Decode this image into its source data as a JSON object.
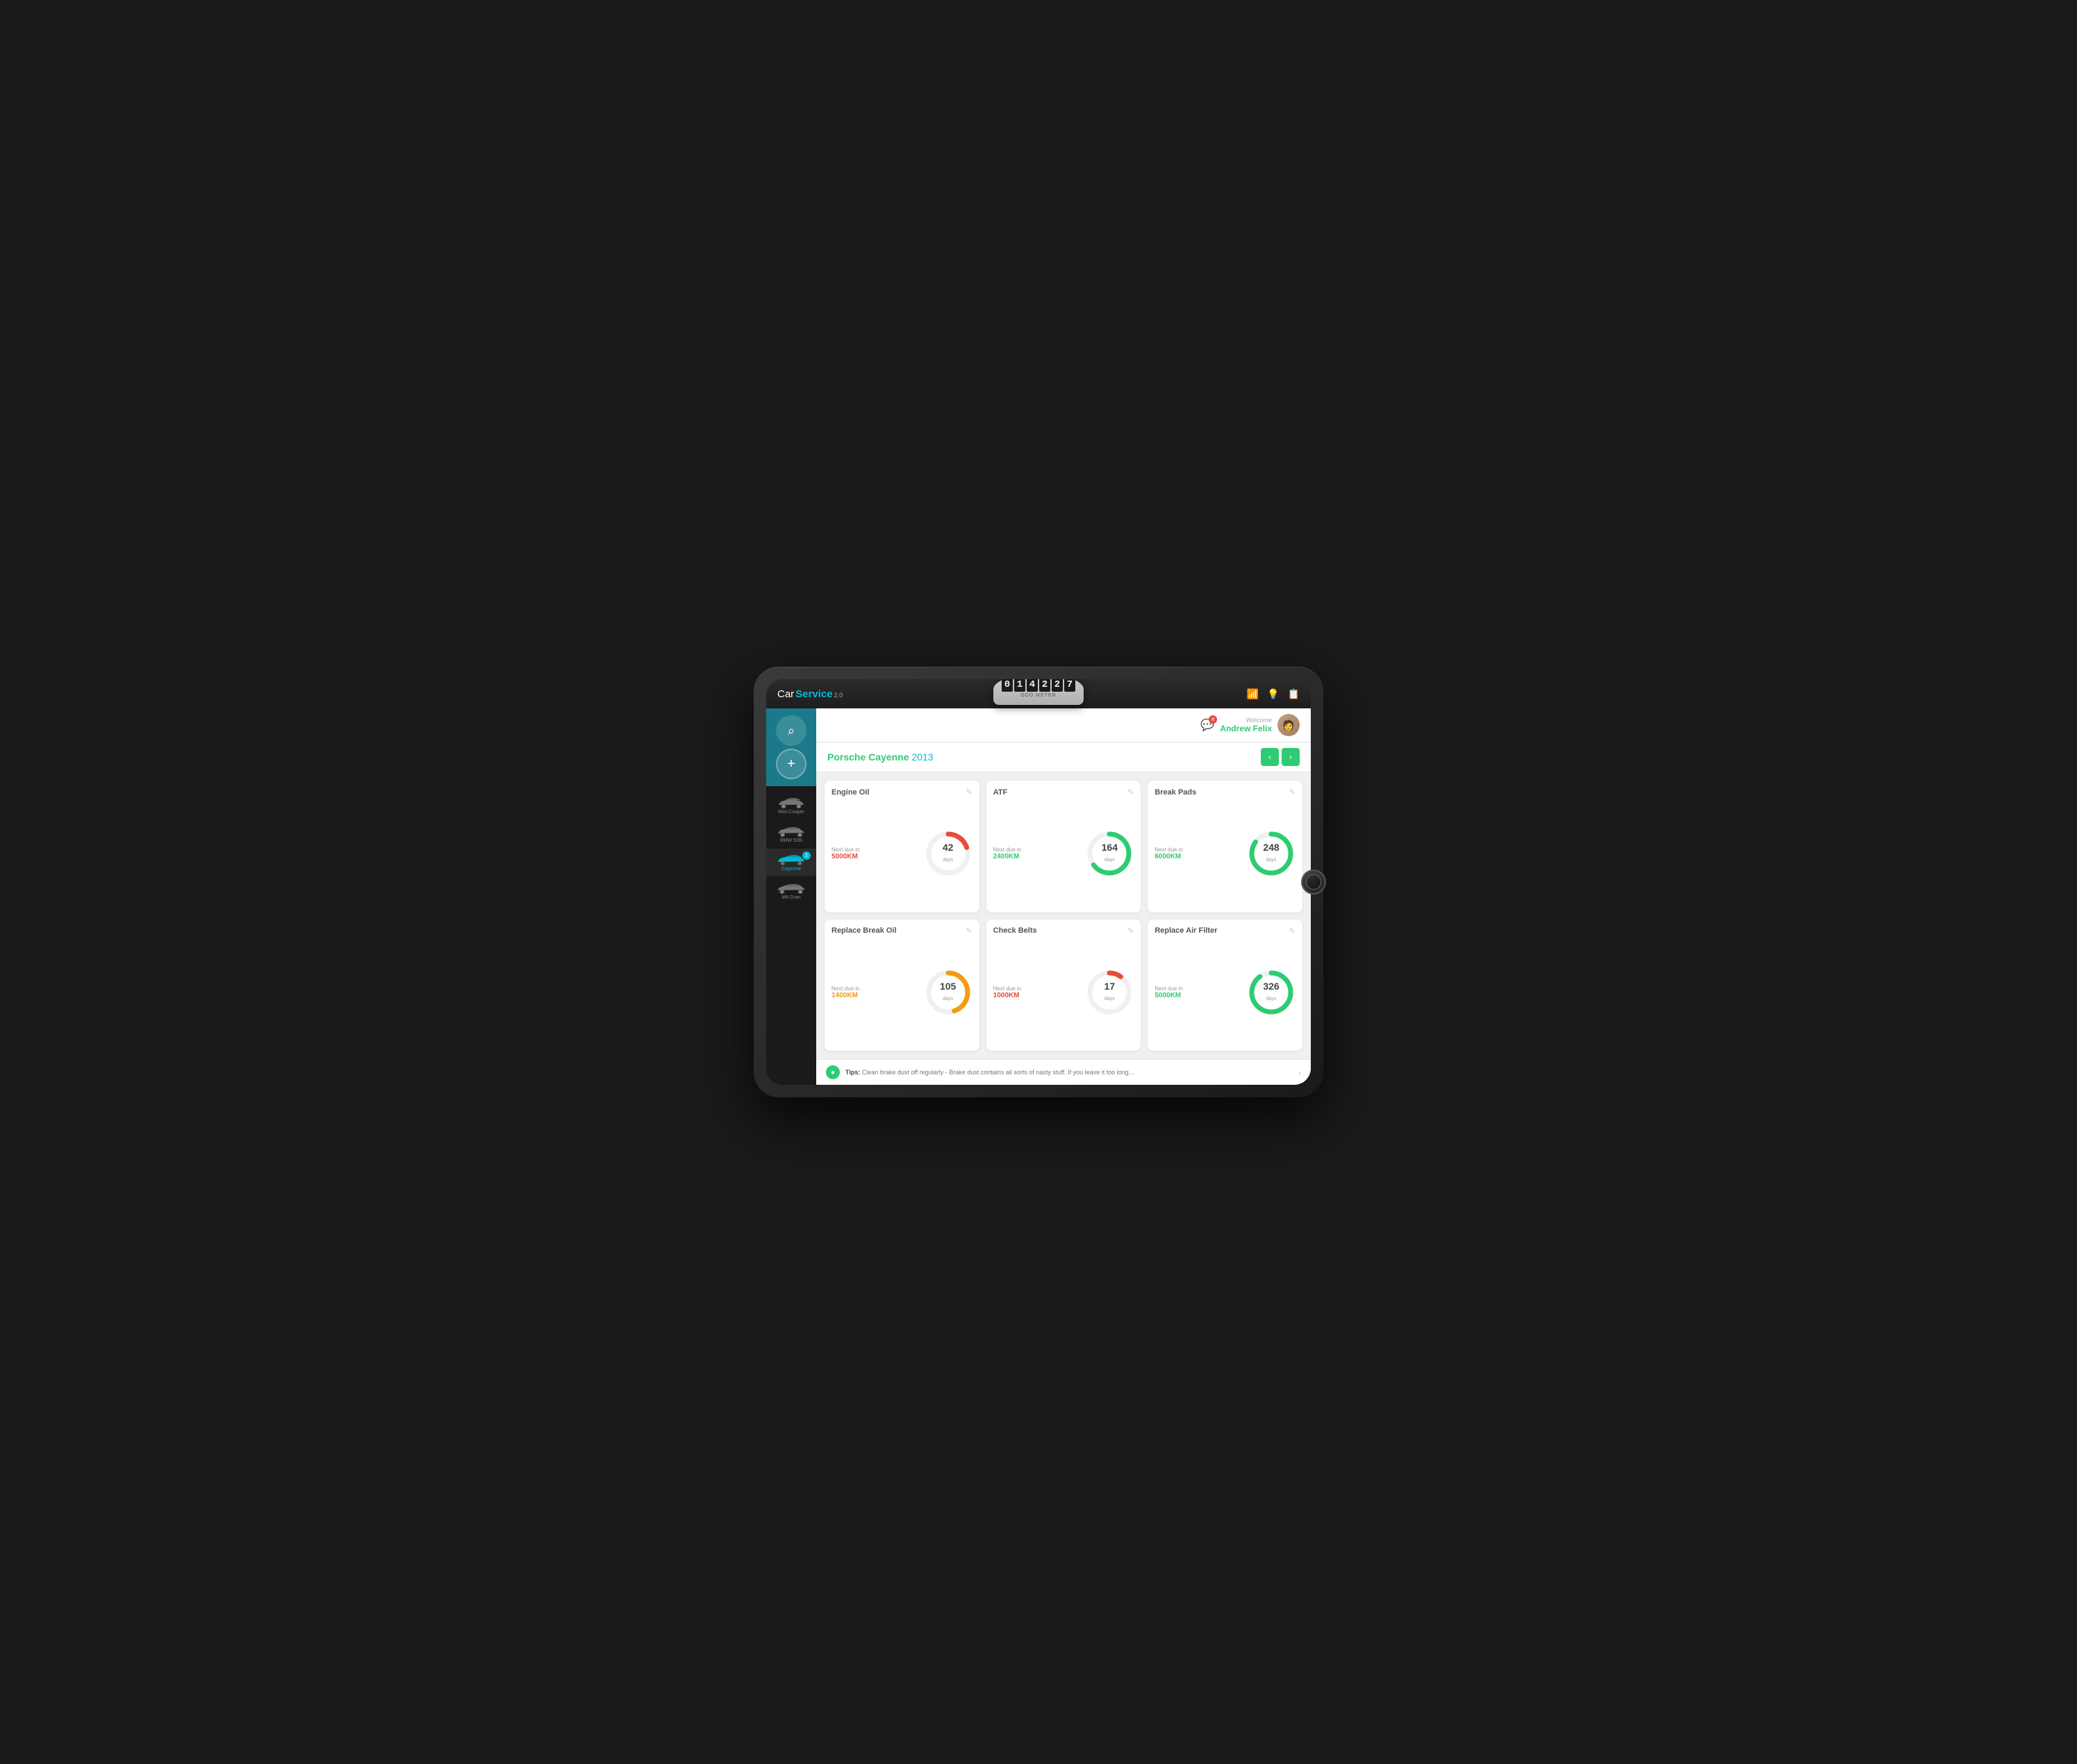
{
  "app": {
    "logo_car": "Car",
    "logo_service": "Service",
    "logo_version": "2.0"
  },
  "odo": {
    "digits": [
      "0",
      "1",
      "4",
      "2",
      "2",
      "7"
    ],
    "label": "ODO METER"
  },
  "top_icons": [
    "wifi",
    "bulb",
    "clipboard"
  ],
  "header": {
    "welcome_label": "Welcome",
    "user_name": "Andrew Felix",
    "notification_count": "8"
  },
  "car_selected": {
    "make": "Porsche Cayenne",
    "year": "2013"
  },
  "sidebar": {
    "cars": [
      {
        "name": "Mini Cooper",
        "active": false,
        "badge": null
      },
      {
        "name": "BMW 528i",
        "active": false,
        "badge": null
      },
      {
        "name": "Cayenne",
        "active": true,
        "badge": "2"
      },
      {
        "name": "M6 Gran",
        "active": false,
        "badge": null
      }
    ]
  },
  "service_cards": [
    {
      "title": "Engine Oil",
      "edit": "✎",
      "next_due_label": "Next due in",
      "next_due_km": "5000KM",
      "km_color": "red",
      "days": "42",
      "unit": "days",
      "donut_color": "#e74c3c",
      "donut_pct": 20
    },
    {
      "title": "ATF",
      "edit": "✎",
      "next_due_label": "Next due in",
      "next_due_km": "2400KM",
      "km_color": "green",
      "days": "164",
      "unit": "days",
      "donut_color": "#2ecc71",
      "donut_pct": 65
    },
    {
      "title": "Break Pads",
      "edit": "✎",
      "next_due_label": "Next due in",
      "next_due_km": "6000KM",
      "km_color": "green",
      "days": "248",
      "unit": "days",
      "donut_color": "#2ecc71",
      "donut_pct": 85
    },
    {
      "title": "Replace Break Oil",
      "edit": "✎",
      "next_due_label": "Next due in",
      "next_due_km": "1400KM",
      "km_color": "orange",
      "days": "105",
      "unit": "days",
      "donut_color": "#f39c12",
      "donut_pct": 45
    },
    {
      "title": "Check Belts",
      "edit": "✎",
      "next_due_label": "Next due in",
      "next_due_km": "1000KM",
      "km_color": "red",
      "days": "17",
      "unit": "days",
      "donut_color": "#e74c3c",
      "donut_pct": 10
    },
    {
      "title": "Replace Air Filter",
      "edit": "✎",
      "next_due_label": "Next due in",
      "next_due_km": "5000KM",
      "km_color": "green",
      "days": "326",
      "unit": "days",
      "donut_color": "#2ecc71",
      "donut_pct": 90
    }
  ],
  "tips": {
    "label": "Tips:",
    "text": "Clean brake dust off regularly - Brake dust contains all sorts of nasty stuff. If you leave it too long..."
  }
}
